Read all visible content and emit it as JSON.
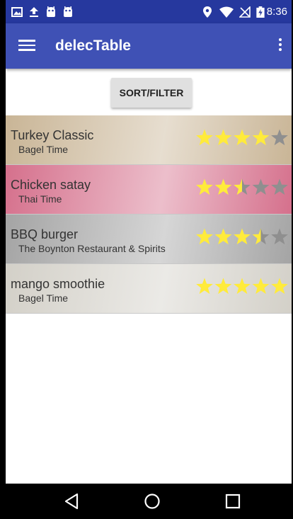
{
  "status_bar": {
    "left_icons": [
      "image-icon",
      "upload-icon",
      "android-icon",
      "android-icon"
    ],
    "right_icons": [
      "location-icon",
      "wifi-icon",
      "no-signal-icon",
      "battery-charging-icon"
    ],
    "time": "8:36"
  },
  "app_bar": {
    "title": "delecTable",
    "menu_icon": "hamburger-menu-icon",
    "overflow_icon": "more-vert-icon"
  },
  "toolbar": {
    "sort_filter_label": "SORT/FILTER"
  },
  "restaurants": [
    {
      "name": "Turkey Classic",
      "place": "Bagel Time",
      "rating": 4,
      "bg_color": "#c9b596"
    },
    {
      "name": "Chicken satay",
      "place": "Thai Time",
      "rating": 2.5,
      "bg_color": "#d5708c"
    },
    {
      "name": "BBQ burger",
      "place": "The Boynton Restaurant & Spirits",
      "rating": 3.5,
      "bg_color": "#a4a4a4"
    },
    {
      "name": "mango smoothie",
      "place": "Bagel Time",
      "rating": 5,
      "bg_color": "#d3d0c8"
    }
  ],
  "colors": {
    "star_filled": "#ffeb3b",
    "star_empty": "#8f8f8f",
    "primary": "#3f51b5",
    "primary_dark": "#26389e"
  },
  "nav_bar": {
    "back_icon": "back-triangle-icon",
    "home_icon": "home-circle-icon",
    "recents_icon": "recents-square-icon"
  }
}
